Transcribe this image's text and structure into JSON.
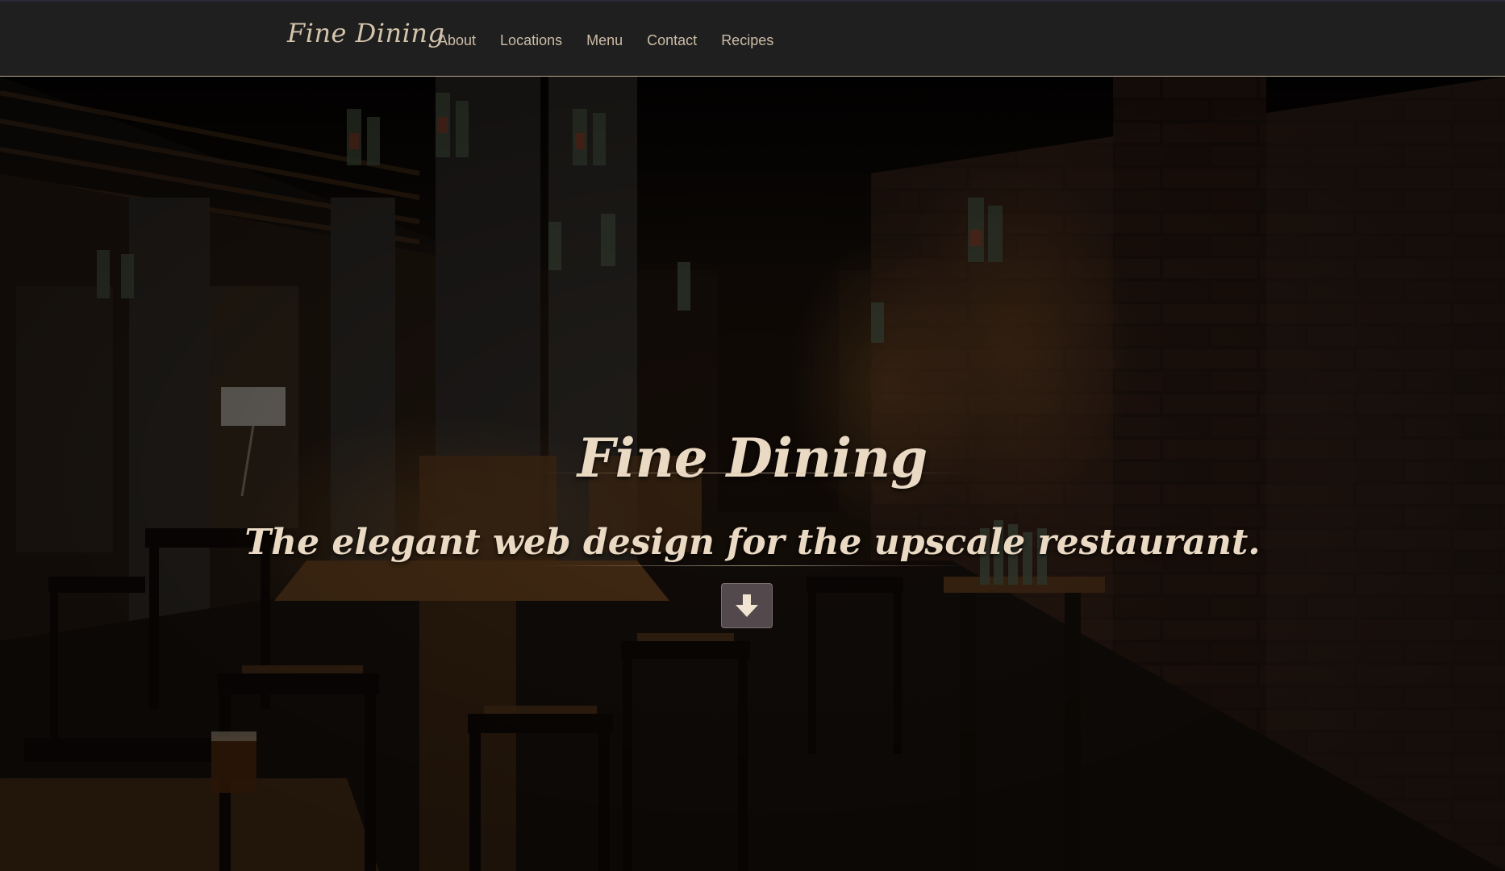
{
  "navbar": {
    "brand": "Fine Dining",
    "links": [
      {
        "label": "About"
      },
      {
        "label": "Locations"
      },
      {
        "label": "Menu"
      },
      {
        "label": "Contact"
      },
      {
        "label": "Recipes"
      }
    ]
  },
  "hero": {
    "title": "Fine Dining",
    "subtitle": "The elegant web design for the upscale restaurant.",
    "scroll_icon": "arrow-down-icon"
  },
  "colors": {
    "navbar_bg": "#1f1f1f",
    "accent_text": "#ead9c3",
    "nav_text": "#cbbca6",
    "nav_border": "#b9a68a"
  }
}
